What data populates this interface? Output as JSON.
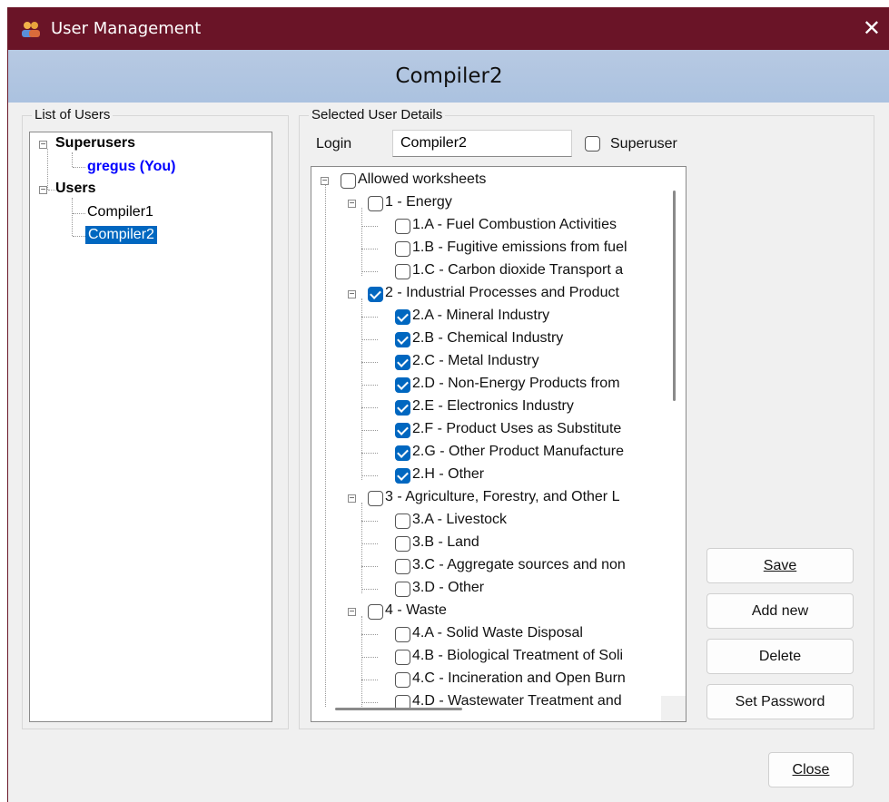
{
  "window": {
    "title": "User Management",
    "close_glyph": "✕"
  },
  "banner": {
    "user": "Compiler2"
  },
  "users_panel": {
    "label": "List of Users",
    "superusers_label": "Superusers",
    "superuser_item": "gregus (You)",
    "users_label": "Users",
    "user_items": [
      "Compiler1",
      "Compiler2"
    ],
    "selected_index": 1
  },
  "details_panel": {
    "label": "Selected User Details",
    "login_label": "Login",
    "login_value": "Compiler2",
    "superuser_label": "Superuser",
    "superuser_checked": false
  },
  "worksheets": {
    "root_label": "Allowed worksheets",
    "groups": [
      {
        "label": "1 - Energy",
        "checked": false,
        "items": [
          {
            "label": "1.A - Fuel Combustion Activities",
            "checked": false
          },
          {
            "label": "1.B - Fugitive emissions from fuel",
            "checked": false
          },
          {
            "label": "1.C - Carbon dioxide Transport a",
            "checked": false
          }
        ]
      },
      {
        "label": "2 - Industrial Processes and Product",
        "checked": true,
        "items": [
          {
            "label": "2.A - Mineral Industry",
            "checked": true
          },
          {
            "label": "2.B - Chemical Industry",
            "checked": true
          },
          {
            "label": "2.C - Metal Industry",
            "checked": true
          },
          {
            "label": "2.D - Non-Energy Products from",
            "checked": true
          },
          {
            "label": "2.E - Electronics Industry",
            "checked": true
          },
          {
            "label": "2.F - Product Uses as Substitute",
            "checked": true
          },
          {
            "label": "2.G - Other Product Manufacture",
            "checked": true
          },
          {
            "label": "2.H - Other",
            "checked": true
          }
        ]
      },
      {
        "label": "3 - Agriculture, Forestry, and Other L",
        "checked": false,
        "items": [
          {
            "label": "3.A - Livestock",
            "checked": false
          },
          {
            "label": "3.B - Land",
            "checked": false
          },
          {
            "label": "3.C - Aggregate sources and non",
            "checked": false
          },
          {
            "label": "3.D - Other",
            "checked": false
          }
        ]
      },
      {
        "label": "4 - Waste",
        "checked": false,
        "items": [
          {
            "label": "4.A - Solid Waste Disposal",
            "checked": false
          },
          {
            "label": "4.B - Biological Treatment of Soli",
            "checked": false
          },
          {
            "label": "4.C - Incineration and Open Burn",
            "checked": false
          },
          {
            "label": "4.D - Wastewater Treatment and",
            "checked": false
          }
        ]
      }
    ]
  },
  "buttons": {
    "save": "Save",
    "add_new": "Add new",
    "delete": "Delete",
    "set_password": "Set Password",
    "close": "Close"
  },
  "colors": {
    "titlebar": "#6a1427",
    "banner": "#b7c9e2",
    "selection": "#0067c0",
    "superuser_text": "#0000ff",
    "checked": "#0067c0"
  }
}
